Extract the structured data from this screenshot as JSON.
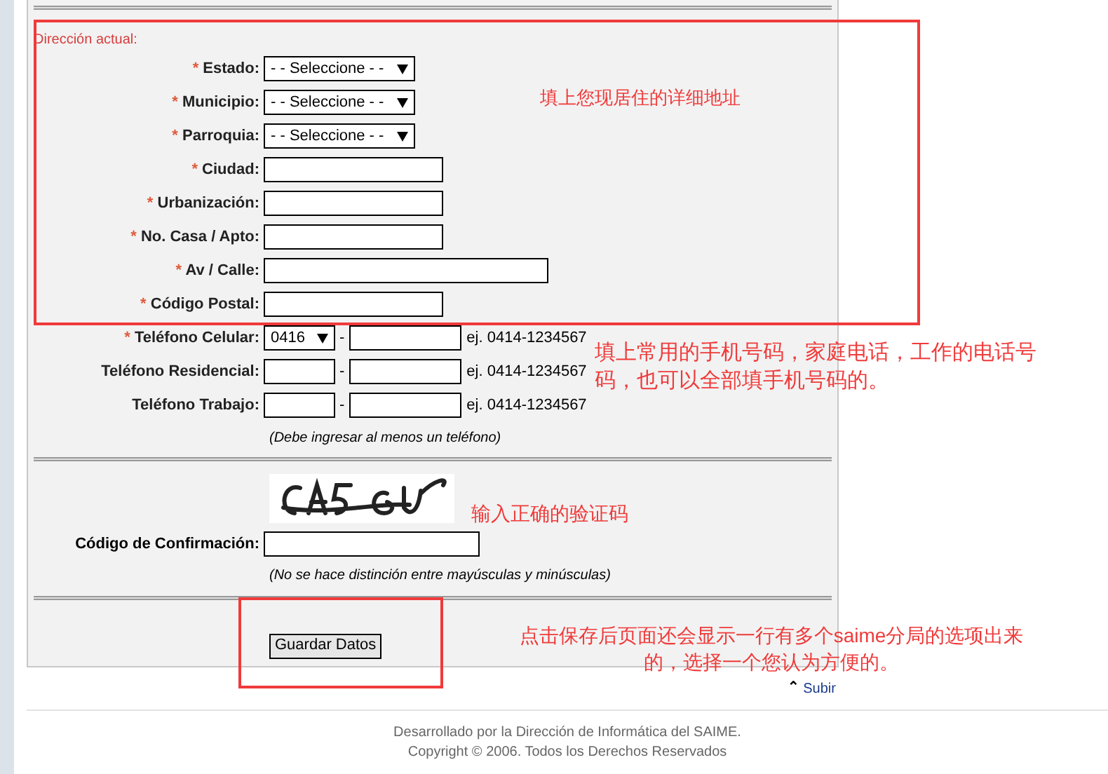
{
  "section_title": "Dirección actual:",
  "address_fields": [
    {
      "label": "Estado:",
      "required": true,
      "kind": "select",
      "value": "- - Seleccione - -"
    },
    {
      "label": "Municipio:",
      "required": true,
      "kind": "select",
      "value": "- - Seleccione - -"
    },
    {
      "label": "Parroquia:",
      "required": true,
      "kind": "select",
      "value": "- - Seleccione - -"
    },
    {
      "label": "Ciudad:",
      "required": true,
      "kind": "short"
    },
    {
      "label": "Urbanización:",
      "required": true,
      "kind": "short"
    },
    {
      "label": "No. Casa / Apto:",
      "required": true,
      "kind": "short"
    },
    {
      "label": "Av / Calle:",
      "required": true,
      "kind": "long"
    },
    {
      "label": "Código Postal:",
      "required": true,
      "kind": "short"
    }
  ],
  "required_mark": "*",
  "phones": [
    {
      "label": "Teléfono Celular:",
      "required": true,
      "kind": "select",
      "area_value": "0416",
      "separator": "-",
      "example": "ej. 0414-1234567"
    },
    {
      "label": "Teléfono Residencial:",
      "required": false,
      "kind": "text",
      "separator": "-",
      "example": "ej. 0414-1234567"
    },
    {
      "label": "Teléfono Trabajo:",
      "required": false,
      "kind": "text",
      "separator": "-",
      "example": "ej. 0414-1234567"
    }
  ],
  "phone_note": "(Debe ingresar al menos un teléfono)",
  "captcha": {
    "label": "Código de Confirmación:",
    "note": "(No se hace distinción entre mayúsculas y minúsculas)"
  },
  "save_button": "Guardar Datos",
  "top_link": {
    "icon": "⌃",
    "label": "Subir"
  },
  "footer": [
    "Desarrollado por la Dirección de Informática del SAIME.",
    "Copyright © 2006. Todos los Derechos Reservados"
  ],
  "annotations": [
    "填上您现居住的详细地址",
    "填上常用的手机号码，家庭电话，工作的电话号码，也可以全部填手机号码的。",
    "输入正确的验证码",
    "点击保存后页面还会显示一行有多个saime分局的选项出来的，选择一个您认为方便的。"
  ]
}
